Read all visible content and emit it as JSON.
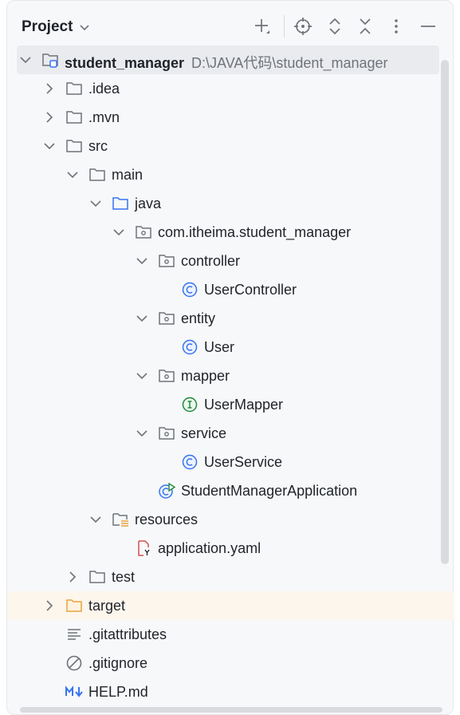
{
  "header": {
    "title": "Project",
    "icons": [
      "add-icon",
      "locate-icon",
      "expand-all-icon",
      "collapse-all-icon",
      "more-options-icon",
      "minimize-icon"
    ]
  },
  "tree": {
    "root": {
      "label": "student_manager",
      "path": "D:\\JAVA代码\\student_manager",
      "icon": "module-folder-icon"
    },
    "idea": {
      "label": ".idea",
      "icon": "folder-icon"
    },
    "mvn": {
      "label": ".mvn",
      "icon": "folder-icon"
    },
    "src": {
      "label": "src",
      "icon": "folder-icon"
    },
    "main": {
      "label": "main",
      "icon": "folder-icon"
    },
    "java": {
      "label": "java",
      "icon": "source-folder-icon"
    },
    "pkg": {
      "label": "com.itheima.student_manager",
      "icon": "package-icon"
    },
    "controller": {
      "label": "controller",
      "icon": "package-icon"
    },
    "userController": {
      "label": "UserController",
      "icon": "class-icon"
    },
    "entity": {
      "label": "entity",
      "icon": "package-icon"
    },
    "user": {
      "label": "User",
      "icon": "class-icon"
    },
    "mapper": {
      "label": "mapper",
      "icon": "package-icon"
    },
    "userMapper": {
      "label": "UserMapper",
      "icon": "interface-icon"
    },
    "service": {
      "label": "service",
      "icon": "package-icon"
    },
    "userService": {
      "label": "UserService",
      "icon": "class-icon"
    },
    "app": {
      "label": "StudentManagerApplication",
      "icon": "spring-boot-app-icon"
    },
    "resources": {
      "label": "resources",
      "icon": "resources-folder-icon"
    },
    "yaml": {
      "label": "application.yaml",
      "icon": "yaml-file-icon"
    },
    "test": {
      "label": "test",
      "icon": "folder-icon"
    },
    "target": {
      "label": "target",
      "icon": "excluded-folder-icon"
    },
    "gitattributes": {
      "label": ".gitattributes",
      "icon": "text-file-icon"
    },
    "gitignore": {
      "label": ".gitignore",
      "icon": "ignore-file-icon"
    },
    "help": {
      "label": "HELP.md",
      "icon": "markdown-icon"
    }
  },
  "colors": {
    "accent_blue": "#3574f0",
    "interface_green": "#208a3c",
    "excluded_orange": "#e8a33d",
    "yaml_red": "#d64f4f",
    "selected_bg": "#e9ebef",
    "highlight_bg": "#fdf6ec"
  }
}
